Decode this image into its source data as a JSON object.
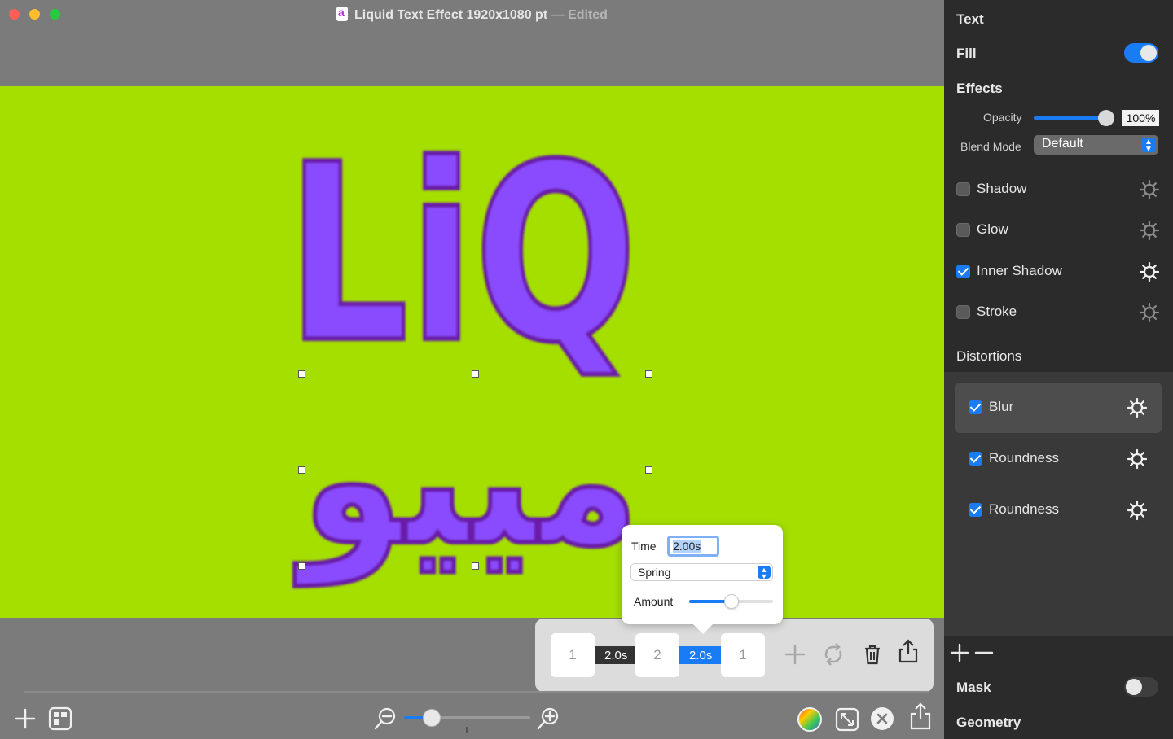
{
  "window": {
    "title": "Liquid Text Effect 1920x1080 pt",
    "title_sep": "—",
    "edited": "Edited"
  },
  "canvas": {
    "line1": "LiQ",
    "line2": "ﻣﯿﯿﻮ"
  },
  "timeline": {
    "keyframes": [
      "1",
      "2",
      "1"
    ],
    "durations": [
      "2.0s",
      "2.0s"
    ]
  },
  "popover": {
    "time_label": "Time",
    "time_value": "2.00s",
    "easing": "Spring",
    "amount_label": "Amount",
    "amount": 0.5
  },
  "inspector": {
    "text_heading": "Text",
    "fill_label": "Fill",
    "fill_on": true,
    "effects_heading": "Effects",
    "opacity_label": "Opacity",
    "opacity_value": "100%",
    "blend_label": "Blend Mode",
    "blend_value": "Default",
    "effects": [
      {
        "label": "Shadow",
        "checked": false
      },
      {
        "label": "Glow",
        "checked": false
      },
      {
        "label": "Inner Shadow",
        "checked": true
      },
      {
        "label": "Stroke",
        "checked": false
      }
    ],
    "distortions_heading": "Distortions",
    "distortions": [
      {
        "label": "Blur",
        "checked": true
      },
      {
        "label": "Roundness",
        "checked": true
      },
      {
        "label": "Roundness",
        "checked": true
      }
    ],
    "mask_label": "Mask",
    "mask_on": false,
    "geometry_heading": "Geometry"
  },
  "colors": {
    "canvas_bg": "#a4df00",
    "accent": "#1a7cf5",
    "liquid": "#8a4bff"
  }
}
